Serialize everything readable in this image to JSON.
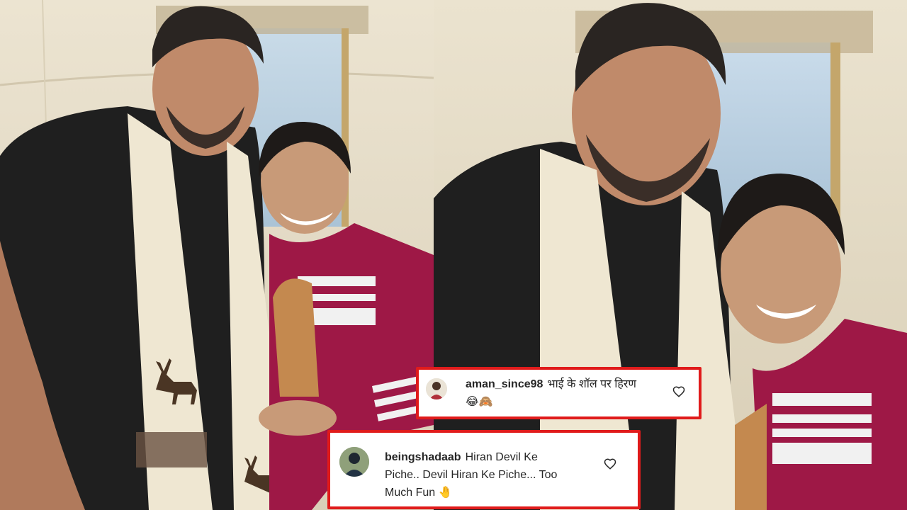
{
  "comments": [
    {
      "username": "aman_since98",
      "text_line1": "भाई के शॉल पर हिरण",
      "text_line2": "😂🙈"
    },
    {
      "username": "beingshadaab",
      "text_line1": "Hiran Devil Ke",
      "text_line2": "Piche.. Devil Hiran Ke Piche... Too",
      "text_line3": "Much Fun 🤚"
    }
  ],
  "colors": {
    "highlight_border": "#e01b1b",
    "jacket": "#9e1846",
    "scarf": "#efe7d2",
    "shirt": "#222222",
    "tent": "#e4dcc8"
  },
  "icons": [
    "heart-outline-icon",
    "user-avatar-icon",
    "deer-emblem-icon"
  ]
}
